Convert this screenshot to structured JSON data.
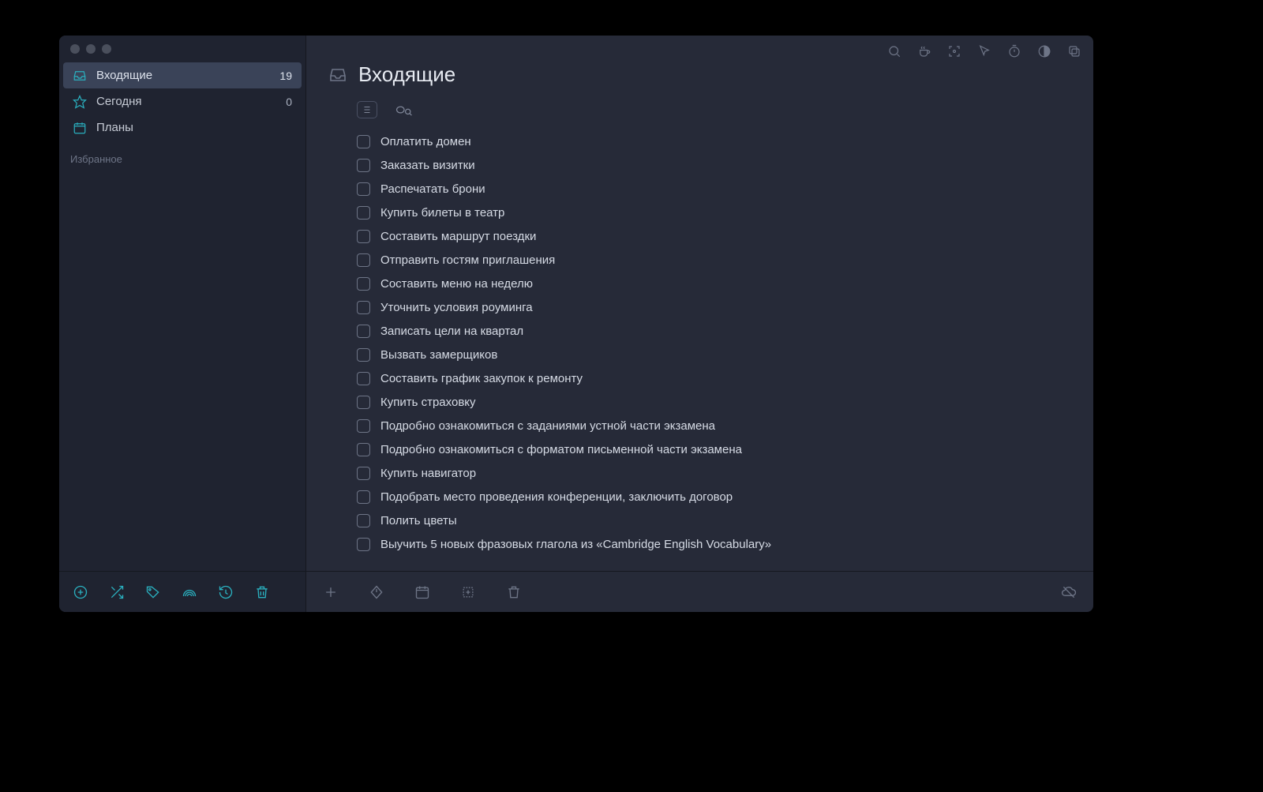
{
  "sidebar": {
    "items": [
      {
        "icon": "inbox",
        "label": "Входящие",
        "count": "19",
        "active": true
      },
      {
        "icon": "star",
        "label": "Сегодня",
        "count": "0",
        "active": false
      },
      {
        "icon": "calendar",
        "label": "Планы",
        "count": "",
        "active": false
      }
    ],
    "sections": [
      {
        "label": "Избранное"
      }
    ]
  },
  "header": {
    "title": "Входящие"
  },
  "tasks": [
    {
      "title": "Оплатить домен"
    },
    {
      "title": "Заказать визитки"
    },
    {
      "title": "Распечатать брони"
    },
    {
      "title": "Купить билеты в театр"
    },
    {
      "title": "Составить маршрут поездки"
    },
    {
      "title": "Отправить гостям приглашения"
    },
    {
      "title": "Составить меню на неделю"
    },
    {
      "title": "Уточнить условия роуминга"
    },
    {
      "title": "Записать цели на квартал"
    },
    {
      "title": "Вызвать замерщиков"
    },
    {
      "title": "Составить график закупок к ремонту"
    },
    {
      "title": "Купить страховку"
    },
    {
      "title": "Подробно ознакомиться с заданиями устной части экзамена"
    },
    {
      "title": "Подробно ознакомиться с форматом письменной части экзамена"
    },
    {
      "title": "Купить навигатор"
    },
    {
      "title": "Подобрать место проведения конференции, заключить договор"
    },
    {
      "title": "Полить цветы"
    },
    {
      "title": "Выучить 5 новых фразовых глагола из «Cambridge English Vocabulary»"
    }
  ]
}
